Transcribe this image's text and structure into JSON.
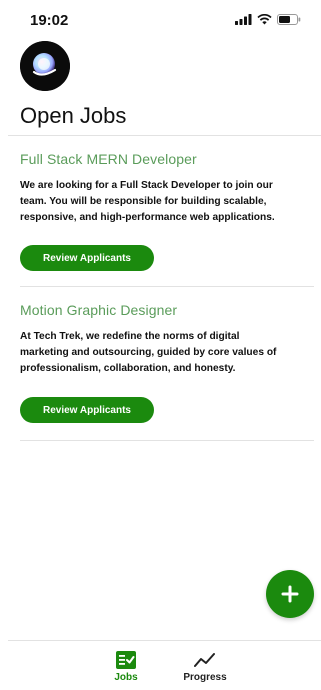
{
  "status_bar": {
    "time": "19:02"
  },
  "header": {
    "avatar_icon": "profile-logo-icon"
  },
  "page": {
    "title": "Open Jobs"
  },
  "jobs": [
    {
      "title": "Full Stack MERN Developer",
      "description": "We are looking for a Full Stack Developer to join our team. You will be responsible for building scalable, responsive, and high-performance web applications.",
      "button_label": "Review Applicants"
    },
    {
      "title": "Motion Graphic Designer",
      "description": "At Tech Trek, we redefine the norms of digital marketing and outsourcing, guided by core values of professionalism, collaboration, and honesty.",
      "button_label": "Review Applicants"
    }
  ],
  "fab": {
    "icon": "plus-icon"
  },
  "tab_bar": {
    "tabs": [
      {
        "label": "Jobs",
        "icon": "jobs-checklist-icon",
        "active": true
      },
      {
        "label": "Progress",
        "icon": "trend-line-icon",
        "active": false
      }
    ]
  },
  "colors": {
    "accent": "#1b8a0e",
    "job_title": "#5a9c5a",
    "divider": "#e2e2e2"
  }
}
